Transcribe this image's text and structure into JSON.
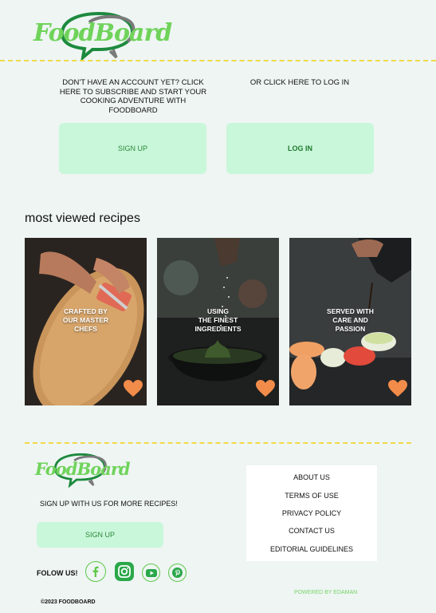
{
  "brand": {
    "name": "FoodBoard",
    "primary_green": "#6fd35a",
    "dark_green": "#1d7a3a",
    "accent_yellow": "#f1d94a",
    "button_green": "#c9f7da",
    "heart_orange": "#f28c4a"
  },
  "auth": {
    "signup_prompt": "DON'T HAVE AN ACCOUNT YET? CLICK HERE TO SUBSCRIBE AND START YOUR COOKING ADVENTURE WITH FOODBOARD",
    "login_prompt": "OR CLICK HERE TO LOG IN",
    "signup_label": "SIGN UP",
    "login_label": "LOG IN"
  },
  "recipes": {
    "title": "most  viewed recipes",
    "cards": [
      {
        "caption": "CRAFTED BY\nOUR MASTER\nCHEFS"
      },
      {
        "caption": "USING\nTHE FINEST\nINGREDIENTS"
      },
      {
        "caption": "SERVED WITH\nCARE AND\nPASSION"
      }
    ]
  },
  "footer": {
    "tagline": "SIGN UP WITH US  FOR  MORE RECIPES!",
    "signup_label": "SIGN UP",
    "links": [
      "ABOUT US",
      "TERMS OF USE",
      "PRIVACY POLICY",
      "CONTACT US",
      "EDITORIAL GUIDELINES"
    ],
    "follow_label": "FOLOW US!",
    "social_icons": [
      "facebook-icon",
      "instagram-icon",
      "youtube-icon",
      "pinterest-icon"
    ],
    "powered_by": "POWERED BY  EDAMAN",
    "copyright": "©2023 FOODBOARD"
  }
}
